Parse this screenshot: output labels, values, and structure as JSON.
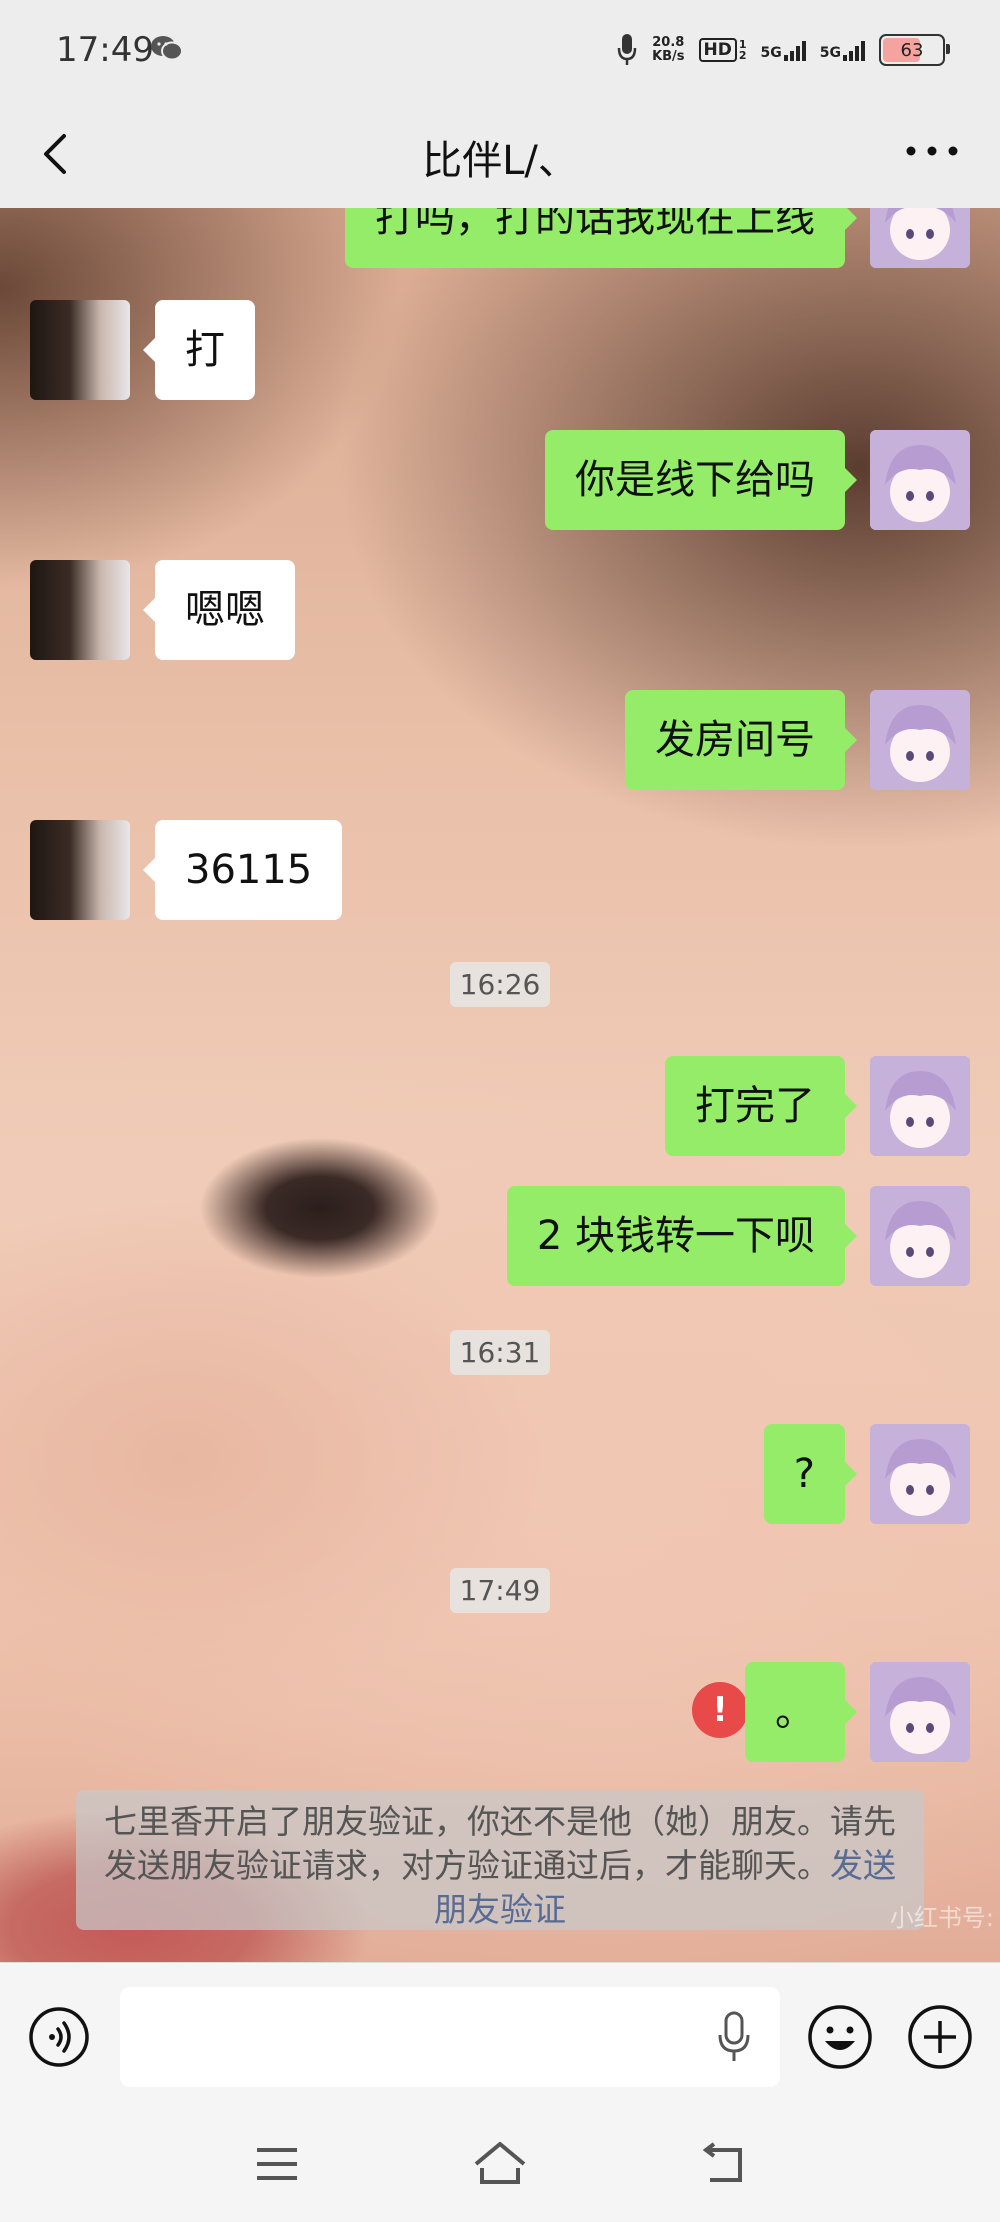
{
  "status_bar": {
    "time": "17:49",
    "speed_top": "20.8",
    "speed_bottom": "KB/s",
    "hd_label": "HD",
    "hd_sub": "1\n2",
    "net1": "5G",
    "net2": "5G",
    "battery": "63"
  },
  "header": {
    "title": "比伴L/、"
  },
  "messages": [
    {
      "side": "right",
      "text": "打吗，打的话我现在上线"
    },
    {
      "side": "left",
      "text": "打"
    },
    {
      "side": "right",
      "text": "你是线下给吗"
    },
    {
      "side": "left",
      "text": "嗯嗯"
    },
    {
      "side": "right",
      "text": "发房间号"
    },
    {
      "side": "left",
      "text": "36115"
    },
    {
      "side": "right",
      "text": "打完了"
    },
    {
      "side": "right",
      "text": "2 块钱转一下呗"
    },
    {
      "side": "right",
      "text": "?"
    },
    {
      "side": "right",
      "text": "。",
      "failed": true
    }
  ],
  "timestamps": [
    "16:26",
    "16:31",
    "17:49"
  ],
  "error_mark": "!",
  "notice": {
    "text": "七里香开启了朋友验证，你还不是他（她）朋友。请先发送朋友验证请求，对方验证通过后，才能聊天。",
    "link": "发送朋友验证"
  },
  "watermark": "小红书号:",
  "input": {
    "value": "",
    "placeholder": ""
  },
  "icons": {
    "back": "back-chevron-icon",
    "more": "more-dots-icon",
    "voice": "voice-mode-icon",
    "mic": "microphone-icon",
    "emoji": "emoji-icon",
    "plus": "plus-icon",
    "menu": "nav-menu-icon",
    "home": "nav-home-icon",
    "navback": "nav-back-icon"
  },
  "colors": {
    "sent_bubble": "#95ec69",
    "received_bubble": "#ffffff",
    "link": "#576b95",
    "error": "#e84a4a"
  }
}
